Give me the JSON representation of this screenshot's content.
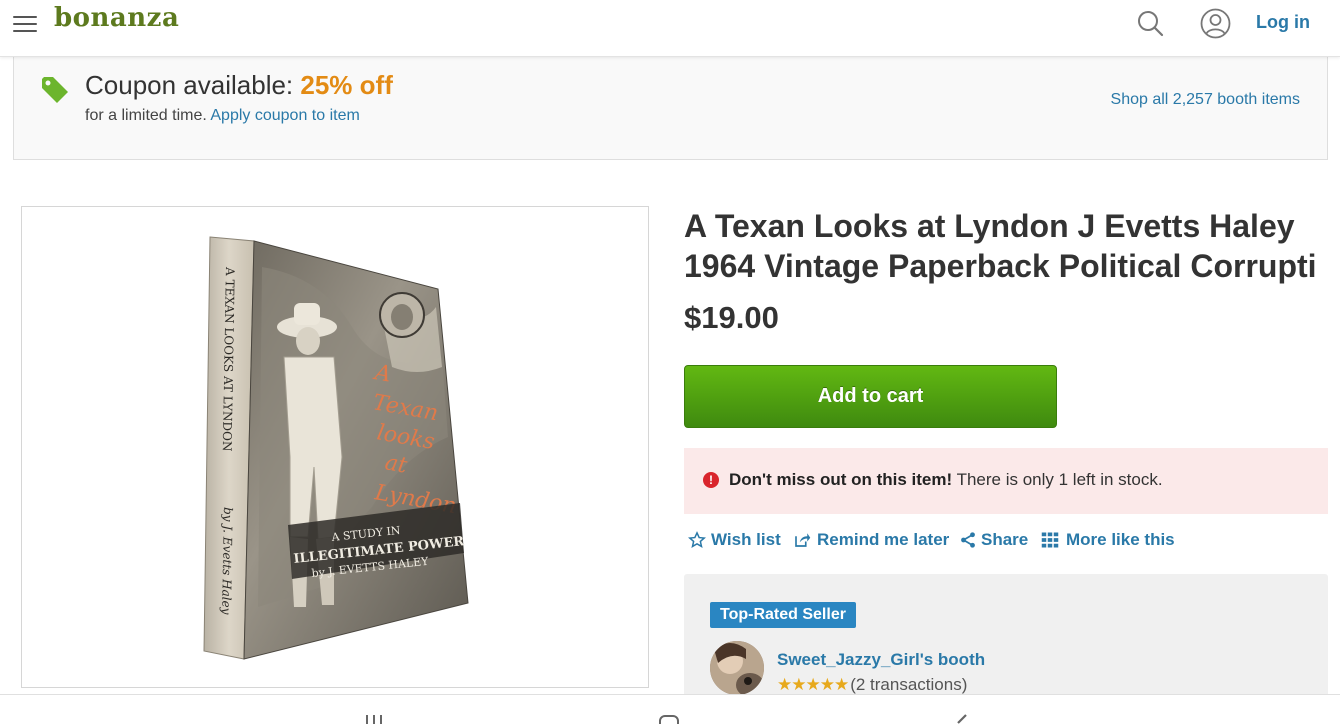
{
  "header": {
    "logo": "bonanza",
    "login_label": "Log in",
    "icons": {
      "menu": "hamburger-icon",
      "search": "search-icon",
      "account": "user-circle-icon"
    }
  },
  "coupon": {
    "title": "Coupon available:",
    "discount": "25% off",
    "subtitle": "for a limited time.",
    "apply_link": "Apply coupon to item",
    "shop_all_link": "Shop all 2,257 booth items",
    "icon": "tag-icon"
  },
  "product": {
    "title": "A Texan Looks at Lyndon J Evetts Haley 1964 Vintage Paperback Political Corrupti",
    "price": "$19.00",
    "add_to_cart": "Add to cart",
    "image": {
      "spine_text": "A TEXAN LOOKS AT LYNDON",
      "spine_author": "by J. Evetts Haley",
      "cover_title": [
        "A",
        "Texan",
        "looks",
        "at",
        "Lyndon"
      ],
      "cover_subtitle": [
        "A STUDY IN",
        "ILLEGITIMATE POWER",
        "by J. EVETTS HALEY"
      ]
    }
  },
  "alert": {
    "bold": "Don't miss out on this item!",
    "text": "There is only 1 left in stock.",
    "icon": "exclamation-icon"
  },
  "actions": [
    {
      "label": "Wish list",
      "icon": "star-outline-icon"
    },
    {
      "label": "Remind me later",
      "icon": "share-box-icon"
    },
    {
      "label": "Share",
      "icon": "share-nodes-icon"
    },
    {
      "label": "More like this",
      "icon": "grid-icon"
    }
  ],
  "seller": {
    "badge": "Top-Rated Seller",
    "booth": "Sweet_Jazzy_Girl's booth",
    "rating_stars": 5,
    "stars_text": "★★★★★",
    "transactions": "(2 transactions)"
  },
  "colors": {
    "brand_green": "#5d7a1e",
    "link_blue": "#2a79a8",
    "coupon_orange": "#e38b14",
    "cart_green": "#4fa010",
    "alert_bg": "#fbe9e9",
    "badge_blue": "#2a86c2"
  },
  "bottom_nav": {
    "icons": [
      "recent-apps-icon",
      "home-icon",
      "back-icon"
    ]
  }
}
